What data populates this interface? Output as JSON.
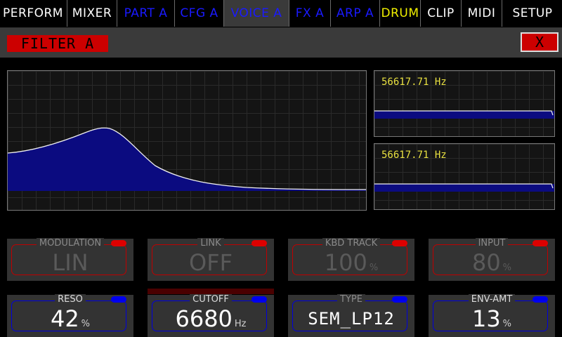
{
  "tabs": [
    {
      "label": "PERFORM",
      "color": "#ffffff",
      "active": false
    },
    {
      "label": "MIXER",
      "color": "#ffffff",
      "active": false
    },
    {
      "label": "PART A",
      "color": "#1a1aff",
      "active": false
    },
    {
      "label": "CFG A",
      "color": "#1a1aff",
      "active": false
    },
    {
      "label": "VOICE A",
      "color": "#1a1aff",
      "active": true
    },
    {
      "label": "FX A",
      "color": "#1a1aff",
      "active": false
    },
    {
      "label": "ARP A",
      "color": "#1a1aff",
      "active": false
    },
    {
      "label": "DRUM",
      "color": "#f0f000",
      "active": false
    },
    {
      "label": "CLIP",
      "color": "#ffffff",
      "active": false
    },
    {
      "label": "MIDI",
      "color": "#ffffff",
      "active": false
    },
    {
      "label": "SETUP",
      "color": "#ffffff",
      "active": false
    }
  ],
  "dialog": {
    "title": "FILTER A",
    "close_label": "X"
  },
  "graphs": {
    "mini1_freq": "56617.71 Hz",
    "mini2_freq": "56617.71 Hz"
  },
  "params": {
    "modulation": {
      "label": "MODULATION",
      "value": "LIN",
      "unit": ""
    },
    "link": {
      "label": "LINK",
      "value": "OFF",
      "unit": ""
    },
    "kbd_track": {
      "label": "KBD TRACK",
      "value": "100",
      "unit": "%"
    },
    "input": {
      "label": "INPUT",
      "value": "80",
      "unit": "%"
    },
    "reso": {
      "label": "RESO",
      "value": "42",
      "unit": "%"
    },
    "cutoff": {
      "label": "CUTOFF",
      "value": "6680",
      "unit": "Hz"
    },
    "type": {
      "label": "TYPE",
      "value": "SEM_LP12",
      "unit": ""
    },
    "env_amt": {
      "label": "ENV-AMT",
      "value": "13",
      "unit": "%"
    }
  },
  "colors": {
    "accent_red": "#cc0000",
    "accent_blue": "#0000ee",
    "freq_yellow": "#e8e040",
    "curve_fill": "#0b0b80"
  }
}
